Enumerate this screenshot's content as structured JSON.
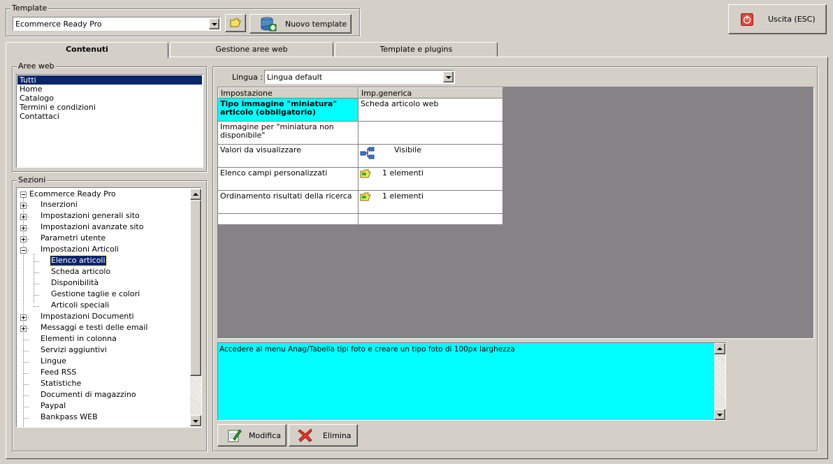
{
  "template": {
    "group_label": "Template",
    "selected": "Ecommerce Ready Pro",
    "new_button": "Nuovo template"
  },
  "exit_button": "Uscita (ESC)",
  "tabs": [
    {
      "label": "Contenuti",
      "active": true
    },
    {
      "label": "Gestione aree web",
      "active": false
    },
    {
      "label": "Template e plugins",
      "active": false
    }
  ],
  "aree_web": {
    "label": "Aree web",
    "items": [
      "Tutti",
      "Home",
      "Catalogo",
      "Termini e condizioni",
      "Contattaci"
    ],
    "selected": "Tutti"
  },
  "sezioni": {
    "label": "Sezioni",
    "root": "Ecommerce Ready Pro",
    "items": [
      {
        "label": "Inserzioni",
        "level": 1,
        "expander": "plus"
      },
      {
        "label": "Impostazioni generali sito",
        "level": 1,
        "expander": "plus"
      },
      {
        "label": "Impostazioni avanzate sito",
        "level": 1,
        "expander": "plus"
      },
      {
        "label": "Parametri utente",
        "level": 1,
        "expander": "plus"
      },
      {
        "label": "Impostazioni Articoli",
        "level": 1,
        "expander": "minus"
      },
      {
        "label": "Elenco articoli",
        "level": 2,
        "selected": true
      },
      {
        "label": "Scheda articolo",
        "level": 2
      },
      {
        "label": "Disponibilità",
        "level": 2
      },
      {
        "label": "Gestione taglie e colori",
        "level": 2
      },
      {
        "label": "Articoli speciali",
        "level": 2
      },
      {
        "label": "Impostazioni Documenti",
        "level": 1,
        "expander": "plus"
      },
      {
        "label": "Messaggi e testi delle email",
        "level": 1,
        "expander": "plus"
      },
      {
        "label": "Elementi in colonna",
        "level": 1
      },
      {
        "label": "Servizi aggiuntivi",
        "level": 1
      },
      {
        "label": "Lingue",
        "level": 1
      },
      {
        "label": "Feed RSS",
        "level": 1
      },
      {
        "label": "Statistiche",
        "level": 1
      },
      {
        "label": "Documenti di magazzino",
        "level": 1
      },
      {
        "label": "Paypal",
        "level": 1
      },
      {
        "label": "Bankpass WEB",
        "level": 1
      }
    ]
  },
  "lingua": {
    "label": "Lingua :",
    "selected": "Lingua default"
  },
  "grid": {
    "headers": [
      "Impostazione",
      "Imp.generica"
    ],
    "rows": [
      {
        "setting": "Tipo immagine \"miniatura\" articolo (obbligatorio)",
        "value": "Scheda articolo web",
        "highlight": true,
        "icon": ""
      },
      {
        "setting": "Immagine per \"miniatura non disponibile\"",
        "value": "",
        "icon": ""
      },
      {
        "setting": "Valori da visualizzare",
        "value": "Visibile",
        "icon": "tree-icon"
      },
      {
        "setting": "Elenco campi personalizzati",
        "value": "1 elementi",
        "icon": "folder-icon"
      },
      {
        "setting": "Ordinamento risultati della ricerca",
        "value": "1 elementi",
        "icon": "folder-icon"
      }
    ]
  },
  "description": "Accedere al menu Anag/Tabella tipi foto e creare un tipo foto di 100px larghezza",
  "buttons": {
    "modifica": "Modifica",
    "elimina": "Elimina"
  },
  "colors": {
    "highlight": "#00ffff",
    "selection": "#0a246a",
    "grid_bg": "#858385"
  }
}
